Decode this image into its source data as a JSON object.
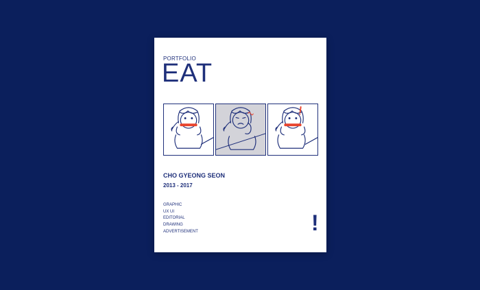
{
  "cover": {
    "kicker": "PORTFOLIO",
    "title": "EAT",
    "author": "CHO GYEONG SEON",
    "years": "2013 - 2017",
    "categories": [
      "GRAPHIC",
      "UX UI",
      "EDITORIAL",
      "DRAWING",
      "ADVERTISEMENT"
    ],
    "mark": "!"
  },
  "colors": {
    "background": "#0b1f5c",
    "ink": "#1e2f7a",
    "accent": "#e8442d",
    "panel_shade": "#d3d3d9"
  },
  "illustrations": [
    "girl-eating-icon",
    "girl-chewing-icon",
    "girl-surprised-icon"
  ]
}
